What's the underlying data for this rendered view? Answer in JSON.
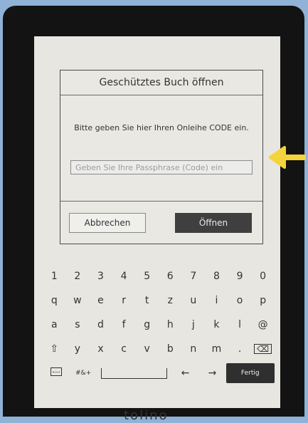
{
  "dialog": {
    "title": "Geschütztes Buch öffnen",
    "message": "Bitte geben Sie hier Ihren Onleihe CODE ein.",
    "input_placeholder": "Geben Sie Ihre Passphrase (Code) ein",
    "cancel_label": "Abbrechen",
    "open_label": "Öffnen"
  },
  "keyboard": {
    "row1": [
      "1",
      "2",
      "3",
      "4",
      "5",
      "6",
      "7",
      "8",
      "9",
      "0"
    ],
    "row2": [
      "q",
      "w",
      "e",
      "r",
      "t",
      "z",
      "u",
      "i",
      "o",
      "p"
    ],
    "row3": [
      "a",
      "s",
      "d",
      "f",
      "g",
      "h",
      "j",
      "k",
      "l",
      "@"
    ],
    "row4": [
      "y",
      "x",
      "c",
      "v",
      "b",
      "n",
      "m",
      "."
    ],
    "symbols_label": "#&+",
    "left_arrow": "←",
    "right_arrow": "→",
    "shift_glyph": "⇧",
    "backspace_glyph": "⌫",
    "done_label": "Fertig"
  },
  "logo_text": "tolino",
  "annotation": {
    "arrow_color": "#f5d33a"
  }
}
